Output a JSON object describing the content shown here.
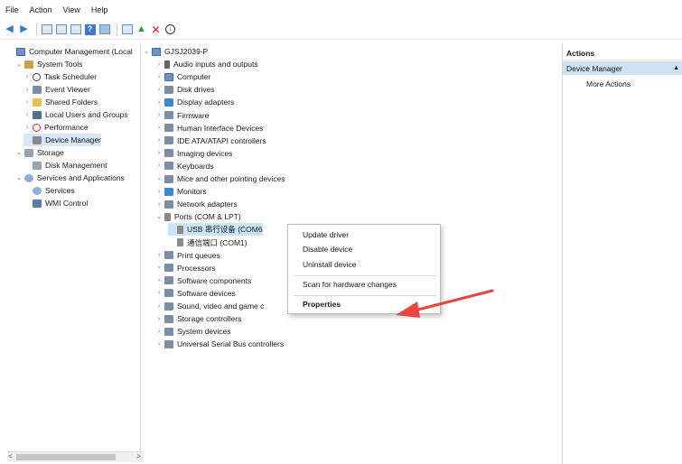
{
  "menu": [
    "File",
    "Action",
    "View",
    "Help"
  ],
  "left_tree": [
    {
      "label": "Computer Management (Local",
      "icon": "computer-icon",
      "exp": "",
      "indent": 0
    },
    {
      "label": "System Tools",
      "icon": "tools-icon",
      "exp": "v",
      "indent": 1
    },
    {
      "label": "Task Scheduler",
      "icon": "clock-icon",
      "exp": ">",
      "indent": 2
    },
    {
      "label": "Event Viewer",
      "icon": "event-viewer-icon",
      "exp": ">",
      "indent": 2
    },
    {
      "label": "Shared Folders",
      "icon": "folder-icon",
      "exp": ">",
      "indent": 2
    },
    {
      "label": "Local Users and Groups",
      "icon": "users-icon",
      "exp": ">",
      "indent": 2
    },
    {
      "label": "Performance",
      "icon": "performance-icon",
      "exp": ">",
      "indent": 2
    },
    {
      "label": "Device Manager",
      "icon": "device-manager-icon",
      "exp": "",
      "indent": 2,
      "selected": true
    },
    {
      "label": "Storage",
      "icon": "storage-icon",
      "exp": "v",
      "indent": 1
    },
    {
      "label": "Disk Management",
      "icon": "disk-icon",
      "exp": "",
      "indent": 2
    },
    {
      "label": "Services and Applications",
      "icon": "services-apps-icon",
      "exp": "v",
      "indent": 1
    },
    {
      "label": "Services",
      "icon": "services-icon",
      "exp": "",
      "indent": 2
    },
    {
      "label": "WMI Control",
      "icon": "wmi-icon",
      "exp": "",
      "indent": 2
    }
  ],
  "device_tree": [
    {
      "label": "GJSJ2039-P",
      "exp": "v",
      "indent": 0,
      "icon": "computer-icon"
    },
    {
      "label": "Audio inputs and outputs",
      "exp": ">",
      "indent": 1,
      "icon": "audio-icon"
    },
    {
      "label": "Computer",
      "exp": ">",
      "indent": 1,
      "icon": "computer-icon"
    },
    {
      "label": "Disk drives",
      "exp": ">",
      "indent": 1,
      "icon": "disk-drive-icon"
    },
    {
      "label": "Display adapters",
      "exp": ">",
      "indent": 1,
      "icon": "display-adapter-icon"
    },
    {
      "label": "Firmware",
      "exp": ">",
      "indent": 1,
      "icon": "firmware-icon"
    },
    {
      "label": "Human Interface Devices",
      "exp": ">",
      "indent": 1,
      "icon": "hid-icon"
    },
    {
      "label": "IDE ATA/ATAPI controllers",
      "exp": ">",
      "indent": 1,
      "icon": "ide-icon"
    },
    {
      "label": "Imaging devices",
      "exp": ">",
      "indent": 1,
      "icon": "camera-icon"
    },
    {
      "label": "Keyboards",
      "exp": ">",
      "indent": 1,
      "icon": "keyboard-icon"
    },
    {
      "label": "Mice and other pointing devices",
      "exp": ">",
      "indent": 1,
      "icon": "mouse-icon"
    },
    {
      "label": "Monitors",
      "exp": ">",
      "indent": 1,
      "icon": "monitor-icon"
    },
    {
      "label": "Network adapters",
      "exp": ">",
      "indent": 1,
      "icon": "network-icon"
    },
    {
      "label": "Ports (COM & LPT)",
      "exp": "v",
      "indent": 1,
      "icon": "port-icon"
    },
    {
      "label": "USB 串行设备 (COM6",
      "exp": "",
      "indent": 2,
      "icon": "port-device-icon",
      "ctx": true
    },
    {
      "label": "通信端口 (COM1)",
      "exp": "",
      "indent": 2,
      "icon": "port-device-icon"
    },
    {
      "label": "Print queues",
      "exp": ">",
      "indent": 1,
      "icon": "printer-icon"
    },
    {
      "label": "Processors",
      "exp": ">",
      "indent": 1,
      "icon": "processor-icon"
    },
    {
      "label": "Software components",
      "exp": ">",
      "indent": 1,
      "icon": "software-icon"
    },
    {
      "label": "Software devices",
      "exp": ">",
      "indent": 1,
      "icon": "software-icon"
    },
    {
      "label": "Sound, video and game c",
      "exp": ">",
      "indent": 1,
      "icon": "sound-icon"
    },
    {
      "label": "Storage controllers",
      "exp": ">",
      "indent": 1,
      "icon": "storage-controller-icon"
    },
    {
      "label": "System devices",
      "exp": ">",
      "indent": 1,
      "icon": "system-device-icon"
    },
    {
      "label": "Universal Serial Bus controllers",
      "exp": ">",
      "indent": 1,
      "icon": "usb-icon"
    }
  ],
  "context_menu": {
    "update": "Update driver",
    "disable": "Disable device",
    "uninstall": "Uninstall device",
    "scan": "Scan for hardware changes",
    "properties": "Properties"
  },
  "actions": {
    "header": "Actions",
    "section": "Device Manager",
    "more": "More Actions"
  },
  "colors": {
    "selection": "#d9e8f8",
    "annotation_arrow": "#e8453c"
  }
}
